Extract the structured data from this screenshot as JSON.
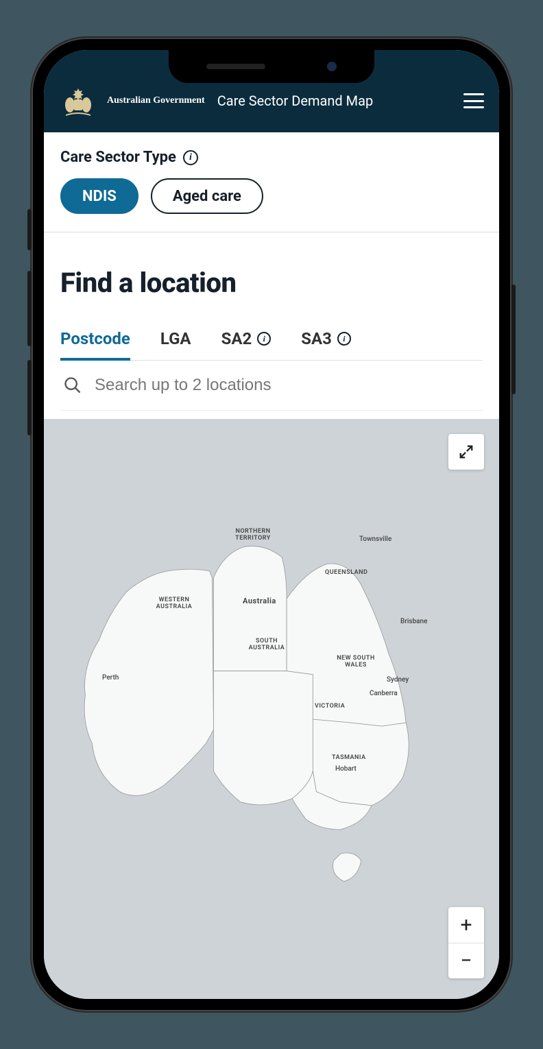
{
  "header": {
    "gov_text": "Australian Government",
    "app_title": "Care Sector Demand Map"
  },
  "sector": {
    "label": "Care Sector Type",
    "options": [
      "NDIS",
      "Aged care"
    ],
    "active": "NDIS"
  },
  "find": {
    "heading": "Find a location",
    "tabs": [
      "Postcode",
      "LGA",
      "SA2",
      "SA3"
    ],
    "active_tab": "Postcode",
    "search_placeholder": "Search up to 2 locations"
  },
  "map": {
    "country": "Australia",
    "states": [
      "WESTERN AUSTRALIA",
      "NORTHERN TERRITORY",
      "SOUTH AUSTRALIA",
      "QUEENSLAND",
      "NEW SOUTH WALES",
      "VICTORIA",
      "TASMANIA"
    ],
    "cities": [
      "Perth",
      "Townsville",
      "Brisbane",
      "Sydney",
      "Canberra",
      "Hobart"
    ]
  }
}
